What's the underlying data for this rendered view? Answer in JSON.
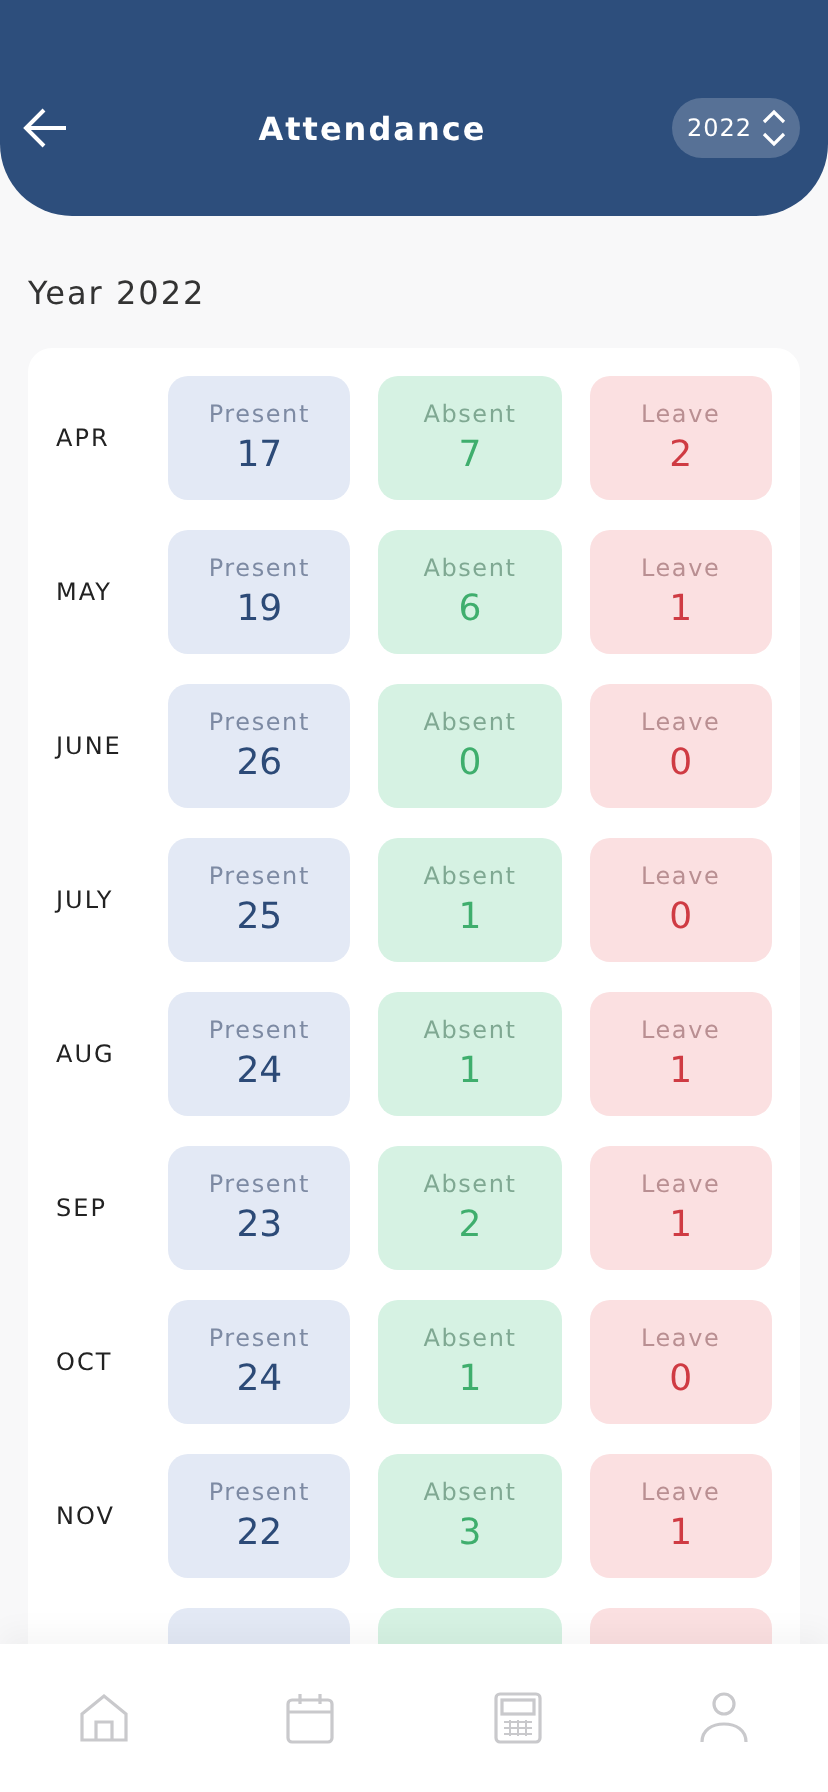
{
  "header": {
    "title": "Attendance",
    "year_picker": "2022"
  },
  "section_title": "Year 2022",
  "months": [
    {
      "month": "APR",
      "stats": [
        {
          "kind": "present",
          "label": "Present",
          "value": "17"
        },
        {
          "kind": "absent",
          "label": "Absent",
          "value": "7"
        },
        {
          "kind": "leave",
          "label": "Leave",
          "value": "2"
        }
      ]
    },
    {
      "month": "MAY",
      "stats": [
        {
          "kind": "present",
          "label": "Present",
          "value": "19"
        },
        {
          "kind": "absent",
          "label": "Absent",
          "value": "6"
        },
        {
          "kind": "leave",
          "label": "Leave",
          "value": "1"
        }
      ]
    },
    {
      "month": "JUNE",
      "stats": [
        {
          "kind": "present",
          "label": "Present",
          "value": "26"
        },
        {
          "kind": "absent",
          "label": "Absent",
          "value": "0"
        },
        {
          "kind": "leave",
          "label": "Leave",
          "value": "0"
        }
      ]
    },
    {
      "month": "JULY",
      "stats": [
        {
          "kind": "present",
          "label": "Present",
          "value": "25"
        },
        {
          "kind": "absent",
          "label": "Absent",
          "value": "1"
        },
        {
          "kind": "leave",
          "label": "Leave",
          "value": "0"
        }
      ]
    },
    {
      "month": "AUG",
      "stats": [
        {
          "kind": "present",
          "label": "Present",
          "value": "24"
        },
        {
          "kind": "absent",
          "label": "Absent",
          "value": "1"
        },
        {
          "kind": "leave",
          "label": "Leave",
          "value": "1"
        }
      ]
    },
    {
      "month": "SEP",
      "stats": [
        {
          "kind": "present",
          "label": "Present",
          "value": "23"
        },
        {
          "kind": "absent",
          "label": "Absent",
          "value": "2"
        },
        {
          "kind": "leave",
          "label": "Leave",
          "value": "1"
        }
      ]
    },
    {
      "month": "OCT",
      "stats": [
        {
          "kind": "present",
          "label": "Present",
          "value": "24"
        },
        {
          "kind": "absent",
          "label": "Absent",
          "value": "1"
        },
        {
          "kind": "leave",
          "label": "Leave",
          "value": "0"
        }
      ]
    },
    {
      "month": "NOV",
      "stats": [
        {
          "kind": "present",
          "label": "Present",
          "value": "22"
        },
        {
          "kind": "absent",
          "label": "Absent",
          "value": "3"
        },
        {
          "kind": "leave",
          "label": "Leave",
          "value": "1"
        }
      ]
    }
  ],
  "cut_row": [
    {
      "kind": "present"
    },
    {
      "kind": "absent"
    },
    {
      "kind": "leave"
    }
  ],
  "bottom_nav": [
    {
      "kind": "home"
    },
    {
      "kind": "calendar"
    },
    {
      "kind": "calculator"
    },
    {
      "kind": "profile"
    }
  ]
}
